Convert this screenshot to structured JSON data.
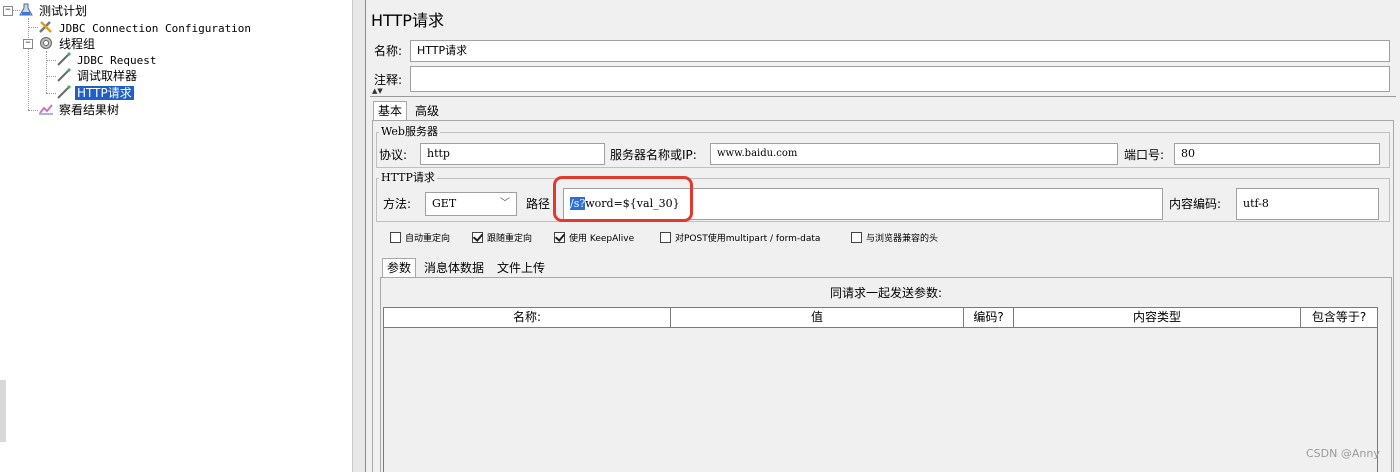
{
  "tree": {
    "items": [
      {
        "label": "测试计划",
        "icon": "test-plan-icon"
      },
      {
        "label": "JDBC Connection Configuration",
        "icon": "jdbc-config-icon"
      },
      {
        "label": "线程组",
        "icon": "thread-group-icon"
      },
      {
        "label": "JDBC Request",
        "icon": "sampler-icon"
      },
      {
        "label": "调试取样器",
        "icon": "sampler-icon"
      },
      {
        "label": "HTTP请求",
        "icon": "sampler-icon",
        "selected": true
      },
      {
        "label": "察看结果树",
        "icon": "results-tree-icon"
      }
    ]
  },
  "panel": {
    "title": "HTTP请求",
    "name_label": "名称:",
    "name_value": "HTTP请求",
    "comment_label": "注释:",
    "comment_value": ""
  },
  "tabs": [
    "基本",
    "高级"
  ],
  "web_server": {
    "legend": "Web服务器",
    "protocol_label": "协议:",
    "protocol_value": "http",
    "server_label": "服务器名称或IP:",
    "server_value": "www.baidu.com",
    "port_label": "端口号:",
    "port_value": "80"
  },
  "http_request": {
    "legend": "HTTP请求",
    "method_label": "方法:",
    "method_value": "GET",
    "path_label": "路径",
    "path_selected": "/s?",
    "path_rest": "word=${val_30}",
    "encoding_label": "内容编码:",
    "encoding_value": "utf-8"
  },
  "checkboxes": [
    {
      "label": "自动重定向",
      "checked": false
    },
    {
      "label": "跟随重定向",
      "checked": true
    },
    {
      "label": "使用 KeepAlive",
      "checked": true
    },
    {
      "label": "对POST使用multipart / form-data",
      "checked": false
    },
    {
      "label": "与浏览器兼容的头",
      "checked": false
    }
  ],
  "subtabs": [
    "参数",
    "消息体数据",
    "文件上传"
  ],
  "params": {
    "caption": "同请求一起发送参数:",
    "columns": [
      "名称:",
      "值",
      "编码?",
      "内容类型",
      "包含等于?"
    ]
  },
  "watermark": "CSDN @Anny",
  "colors": {
    "selection": "#1f5fc7",
    "highlight_box": "#e03a2f",
    "text_selection": "#2b6fd6"
  }
}
